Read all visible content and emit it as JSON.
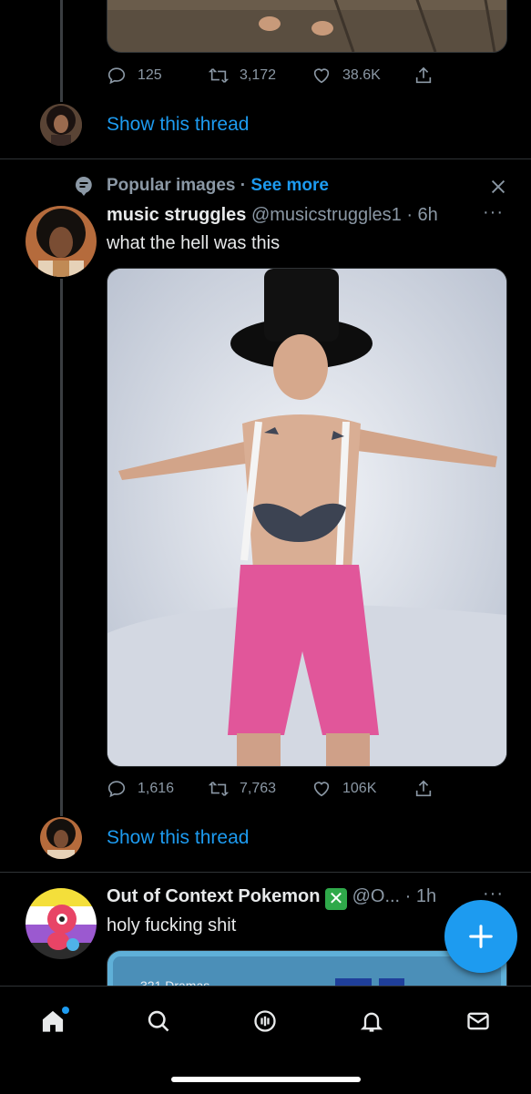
{
  "tweet1": {
    "actions": {
      "replies": "125",
      "retweets": "3,172",
      "likes": "38.6K"
    },
    "show_thread": "Show this thread"
  },
  "tweet2": {
    "context_label": "Popular images",
    "context_sep": "·",
    "see_more": "See more",
    "name": "music struggles",
    "handle": "@musicstruggles1",
    "time": "· 6h",
    "text": "what the hell was this",
    "actions": {
      "replies": "1,616",
      "retweets": "7,763",
      "likes": "106K"
    },
    "show_thread": "Show this thread"
  },
  "tweet3": {
    "name": "Out of Context Pokemon",
    "handle": "@O...",
    "time": "· 1h",
    "text": "holy fucking shit",
    "media_caption": "321 Dramas"
  },
  "icons": {
    "reply": "reply-icon",
    "retweet": "retweet-icon",
    "like": "heart-icon",
    "share": "share-icon",
    "home": "home-icon",
    "search": "search-icon",
    "spaces": "spaces-icon",
    "notifications": "bell-icon",
    "messages": "mail-icon",
    "compose": "compose-plus-icon"
  },
  "colors": {
    "accent": "#1d9bf0",
    "background": "#000000",
    "muted": "#8b98a5"
  }
}
